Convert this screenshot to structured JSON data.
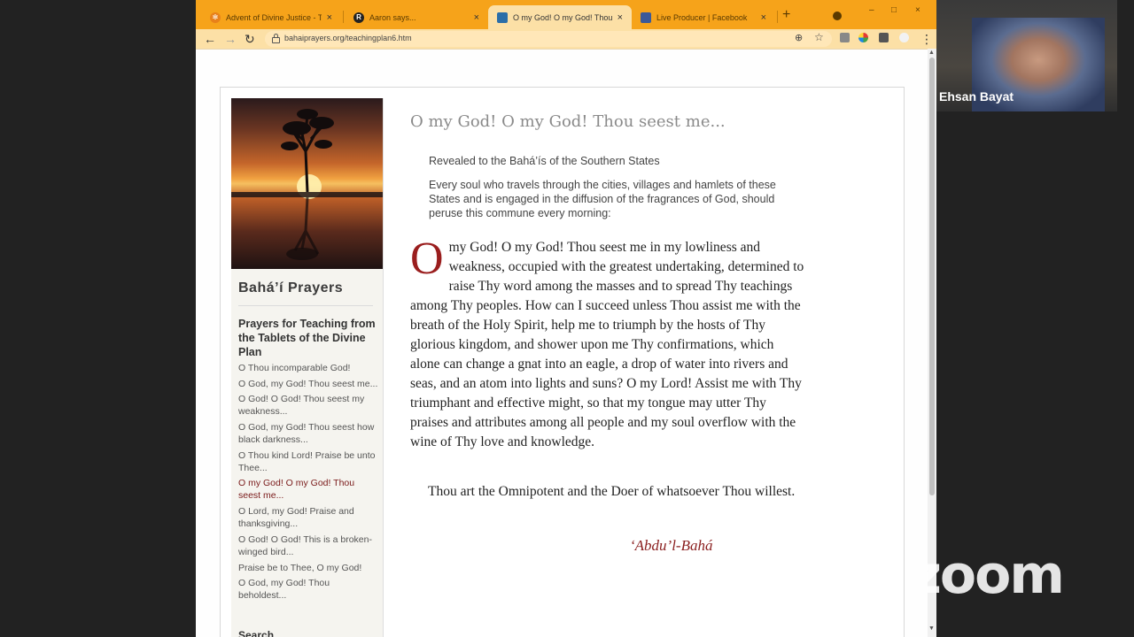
{
  "browser": {
    "tabs": [
      {
        "title": "Advent of Divine Justice - Tho",
        "close": "×",
        "icon": "gear-favicon",
        "color": "#e8811a"
      },
      {
        "title": "Aaron says...",
        "close": "×",
        "icon": "r-favicon",
        "icon_text": "R",
        "color": "#222222"
      },
      {
        "title": "O my God! O my God! Thou se",
        "close": "×",
        "icon": "site-favicon",
        "color": "#2b6ea8"
      },
      {
        "title": "Live Producer | Facebook",
        "close": "×",
        "icon": "facebook-favicon",
        "color": "#3b5998"
      }
    ],
    "new_tab": "+",
    "window_controls": [
      "–",
      "□",
      "×"
    ],
    "nav": {
      "back": "←",
      "forward": "→",
      "reload": "↻"
    },
    "url": "bahaiprayers.org/teachingplan6.htm",
    "zoom_icon": "⊕",
    "star_icon": "☆",
    "menu_icon": "⋮",
    "extension_colors": [
      "#888888",
      "#4caf50",
      "#555555",
      "#cccccc"
    ],
    "scroll_up": "▲",
    "scroll_down": "▼"
  },
  "sidebar": {
    "title": "Bahá’í Prayers",
    "heading": "Prayers for Teaching from the Tablets of the Divine Plan",
    "items": [
      {
        "label": "O Thou incomparable God!"
      },
      {
        "label": "O God, my God! Thou seest me..."
      },
      {
        "label": "O God! O God! Thou seest my weakness..."
      },
      {
        "label": "O God, my God! Thou seest how black darkness..."
      },
      {
        "label": "O Thou kind Lord! Praise be unto Thee..."
      },
      {
        "label": "O my God! O my God! Thou seest me...",
        "current": true
      },
      {
        "label": "O Lord, my God! Praise and thanksgiving..."
      },
      {
        "label": "O God! O God! This is a broken-winged bird..."
      },
      {
        "label": "Praise be to Thee, O my God!"
      },
      {
        "label": "O God, my God! Thou beholdest..."
      }
    ],
    "search_heading": "Search"
  },
  "main": {
    "title": "O my God! O my God! Thou seest me...",
    "revealed": "Revealed to the Bahá’ís of the Southern States",
    "instruction": "Every soul who travels through the cities, villages and hamlets of these States and is engaged in the diffusion of the fragrances of God, should peruse this commune every morning:",
    "dropcap": "O",
    "body": " my God!  O my God!  Thou seest me in my lowliness and weakness, occupied with the greatest undertaking, determined to raise Thy word among the masses and to spread Thy teachings among Thy peoples.  How can I succeed unless Thou assist me with the breath of the Holy Spirit, help me to triumph by the hosts of Thy glorious kingdom, and shower upon me Thy confirmations, which alone can change a gnat into an eagle, a drop of water into rivers and seas, and an atom into lights and suns?  O my Lord!  Assist me with Thy triumphant and effective might, so that my tongue may utter Thy praises and attributes among all people and my soul overflow with the wine of Thy love and knowledge.",
    "closing": "Thou art the Omnipotent and the Doer of whatsoever Thou willest.",
    "author": "‘Abdu’l-Bahá"
  },
  "zoom": {
    "participant_name": "Ehsan Bayat",
    "logo": "zoom"
  }
}
